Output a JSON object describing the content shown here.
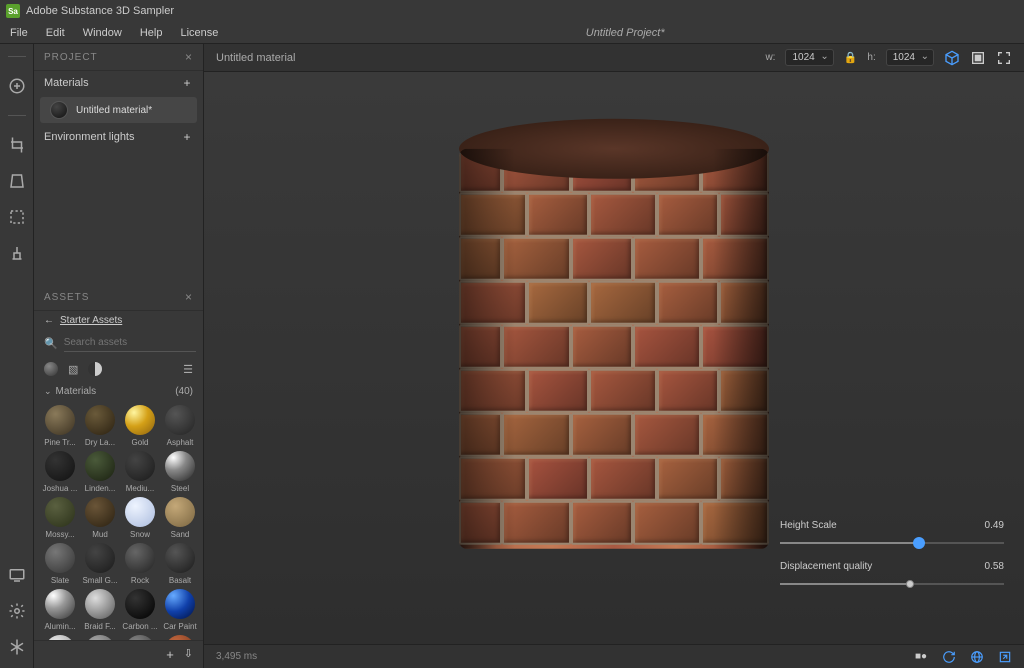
{
  "app": {
    "title": "Adobe Substance 3D Sampler",
    "logo_text": "Sa"
  },
  "menu": {
    "file": "File",
    "edit": "Edit",
    "window": "Window",
    "help": "Help",
    "license": "License",
    "project": "Untitled Project*"
  },
  "project_panel": {
    "title": "PROJECT",
    "materials_label": "Materials",
    "current_material": "Untitled material*",
    "env_label": "Environment lights"
  },
  "assets_panel": {
    "title": "ASSETS",
    "breadcrumb": "Starter Assets",
    "search_placeholder": "Search assets",
    "category_label": "Materials",
    "category_count": "(40)",
    "items": [
      {
        "label": "Pine Tr...",
        "bg": "radial-gradient(circle at 35% 30%, #8a7a5a, #3a3020)"
      },
      {
        "label": "Dry La...",
        "bg": "radial-gradient(circle at 35% 30%, #6a5a3a, #2a2010)"
      },
      {
        "label": "Gold",
        "bg": "radial-gradient(circle at 30% 25%, #fff6a0, #d4a017 45%, #8a6010)"
      },
      {
        "label": "Asphalt",
        "bg": "radial-gradient(circle at 35% 30%, #555, #222)"
      },
      {
        "label": "Joshua ...",
        "bg": "radial-gradient(circle at 35% 30%, #333, #111)"
      },
      {
        "label": "Linden...",
        "bg": "radial-gradient(circle at 35% 30%, #4a5a3a, #1a2010)"
      },
      {
        "label": "Mediu...",
        "bg": "radial-gradient(circle at 35% 30%, #444, #1a1a1a)"
      },
      {
        "label": "Steel",
        "bg": "radial-gradient(circle at 28% 22%, #fff, #888 40%, #222)"
      },
      {
        "label": "Mossy...",
        "bg": "radial-gradient(circle at 35% 30%, #5a6040, #2a3018)"
      },
      {
        "label": "Mud",
        "bg": "radial-gradient(circle at 35% 30%, #6a5538, #2a2010)"
      },
      {
        "label": "Snow",
        "bg": "radial-gradient(circle at 35% 30%, #eef4ff, #aabbdd)"
      },
      {
        "label": "Sand",
        "bg": "radial-gradient(circle at 35% 30%, #c4a878, #7a6540)"
      },
      {
        "label": "Slate",
        "bg": "radial-gradient(circle at 35% 30%, #777, #333)"
      },
      {
        "label": "Small G...",
        "bg": "radial-gradient(circle at 35% 30%, #444, #1a1a1a)"
      },
      {
        "label": "Rock",
        "bg": "radial-gradient(circle at 35% 30%, #666, #222)"
      },
      {
        "label": "Basalt",
        "bg": "radial-gradient(circle at 35% 30%, #555, #1a1a1a)"
      },
      {
        "label": "Alumin...",
        "bg": "radial-gradient(circle at 28% 22%, #fff, #999 40%, #333)"
      },
      {
        "label": "Braid F...",
        "bg": "radial-gradient(circle at 35% 30%, #ddd, #555)"
      },
      {
        "label": "Carbon ...",
        "bg": "radial-gradient(circle at 35% 30%, #333, #000)"
      },
      {
        "label": "Car Paint",
        "bg": "radial-gradient(circle at 28% 22%, #66aaff, #1040aa 50%, #001040)"
      },
      {
        "label": "",
        "bg": "radial-gradient(circle at 35% 30%, #eee, #888)"
      },
      {
        "label": "",
        "bg": "radial-gradient(circle at 35% 30%, #aaa, #555)"
      },
      {
        "label": "",
        "bg": "radial-gradient(circle at 35% 30%, #888, #333)"
      },
      {
        "label": "",
        "bg": "radial-gradient(circle at 35% 30%, #c86a40, #6a3018)"
      }
    ]
  },
  "viewport": {
    "material_name": "Untitled material",
    "w_label": "w:",
    "w_value": "1024",
    "h_label": "h:",
    "h_value": "1024"
  },
  "sliders": {
    "height_label": "Height Scale",
    "height_value": "0.49",
    "height_pct": 62,
    "disp_label": "Displacement quality",
    "disp_value": "0.58",
    "disp_pct": 58
  },
  "status": {
    "render_time": "3,495 ms"
  }
}
